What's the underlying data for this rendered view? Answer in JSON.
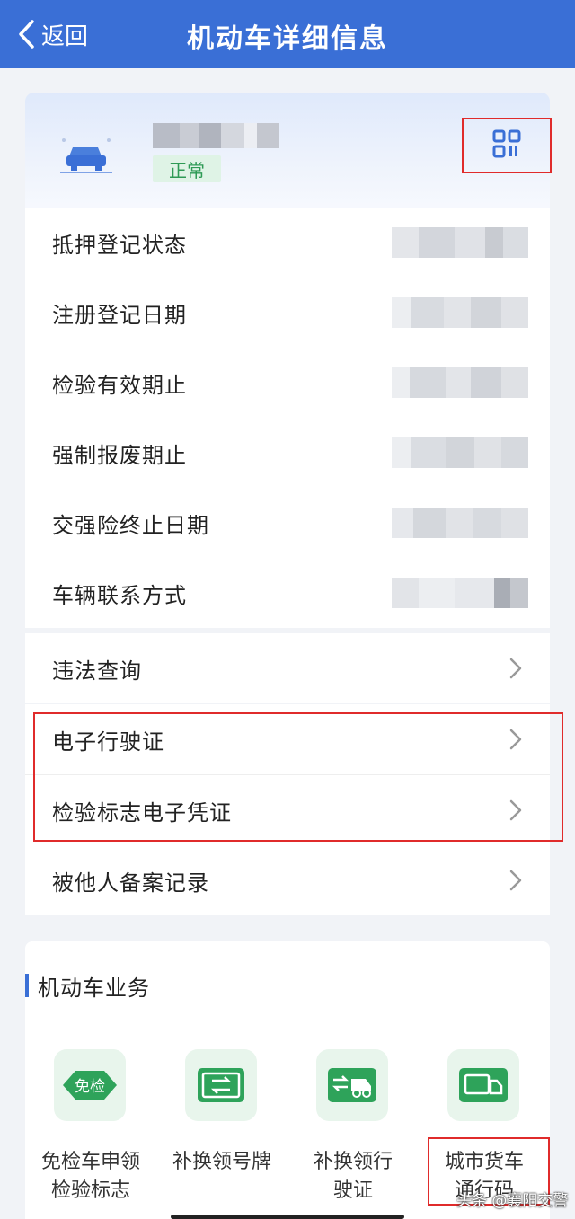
{
  "header": {
    "back_label": "返回",
    "title": "机动车详细信息"
  },
  "vehicle": {
    "status": "正常"
  },
  "info_rows": [
    {
      "label": "抵押登记状态"
    },
    {
      "label": "注册登记日期"
    },
    {
      "label": "检验有效期止"
    },
    {
      "label": "强制报废期止"
    },
    {
      "label": "交强险终止日期"
    },
    {
      "label": "车辆联系方式"
    }
  ],
  "nav_rows": [
    {
      "label": "违法查询"
    },
    {
      "label": "电子行驶证"
    },
    {
      "label": "检验标志电子凭证"
    },
    {
      "label": "被他人备案记录"
    }
  ],
  "business": {
    "title": "机动车业务",
    "services": [
      {
        "label_line1": "免检车申领",
        "label_line2": "检验标志",
        "badge": "免检"
      },
      {
        "label_line1": "补换领号牌",
        "label_line2": ""
      },
      {
        "label_line1": "补换领行",
        "label_line2": "驶证"
      },
      {
        "label_line1": "城市货车",
        "label_line2": "通行码"
      }
    ]
  },
  "watermark": "头条 @襄阳交警",
  "colors": {
    "header_bg": "#3a6fd6",
    "accent_green": "#2ea35a",
    "highlight_red": "#e02b2b"
  }
}
